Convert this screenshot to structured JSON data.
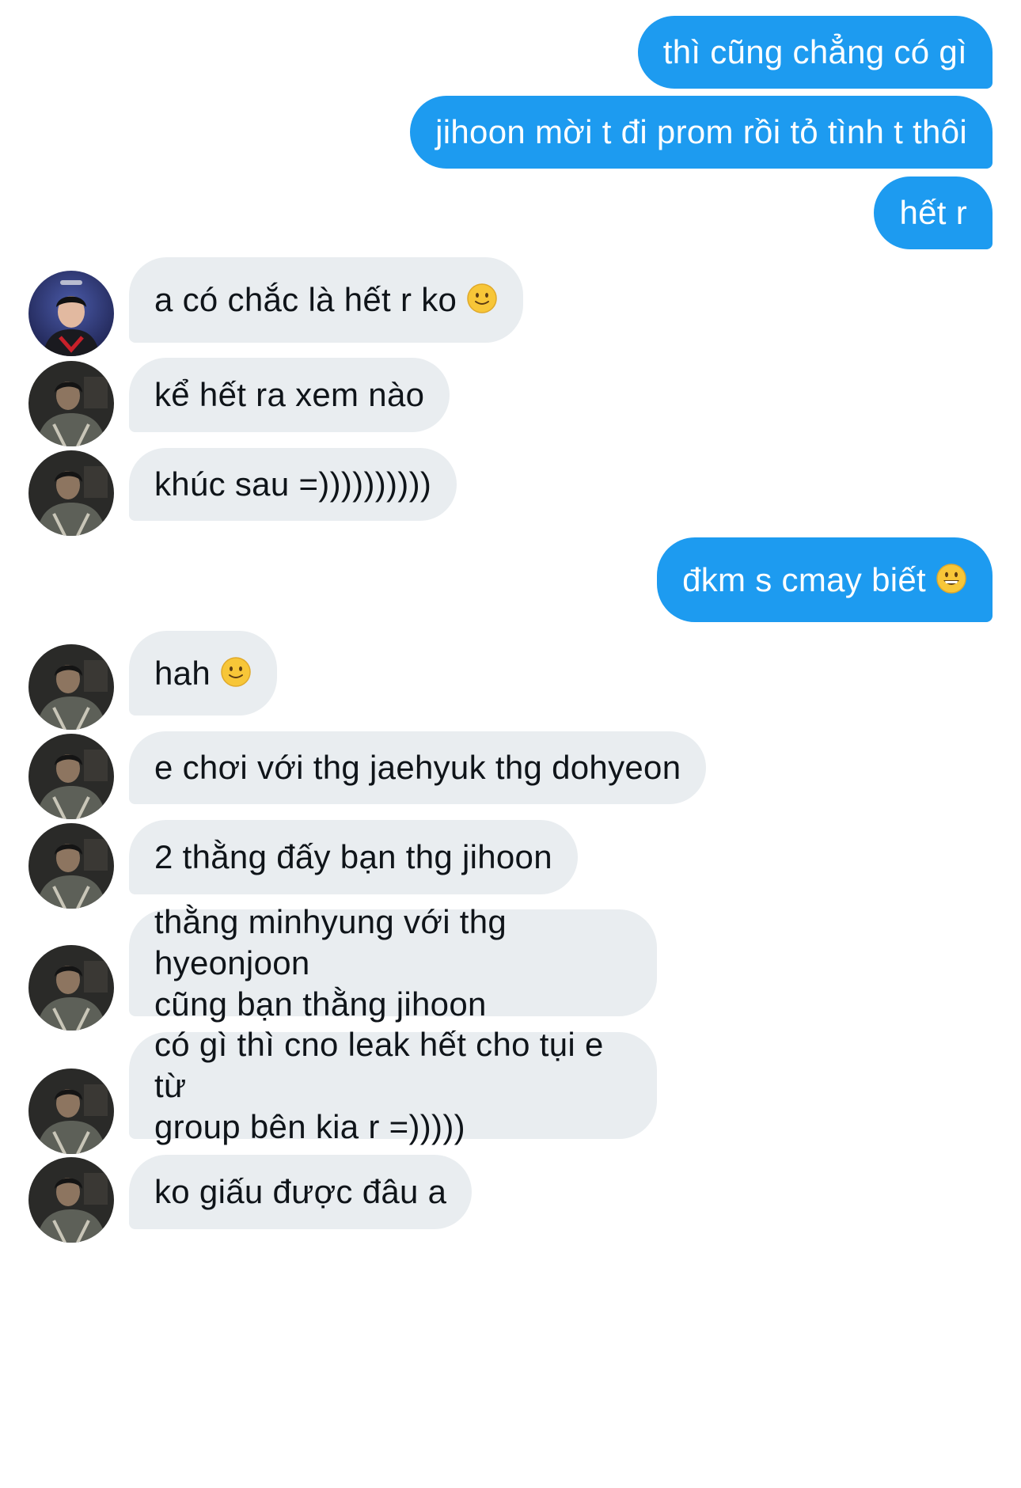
{
  "messages": [
    {
      "side": "sent",
      "text": "thì cũng chẳng có gì"
    },
    {
      "side": "sent",
      "text": "jihoon mời t đi prom rồi tỏ tình t thôi"
    },
    {
      "side": "sent",
      "text": "hết r"
    },
    {
      "side": "received",
      "text": "a có chắc là hết r ko",
      "emoji": "slightly-smiling-face-icon",
      "avatar": "avatar-dark-stage"
    },
    {
      "side": "received",
      "text": "kể hết ra xem nào",
      "avatar": "avatar-dim-jacket"
    },
    {
      "side": "received",
      "text": "khúc sau =))))))))))",
      "avatar": "avatar-dim-jacket"
    },
    {
      "side": "sent",
      "text": "đkm s cmay biết",
      "emoji": "grinning-face-icon"
    },
    {
      "side": "received",
      "text": "hah",
      "emoji": "slightly-smiling-face-icon",
      "avatar": "avatar-dim-jacket"
    },
    {
      "side": "received",
      "text": "e chơi với thg jaehyuk thg dohyeon",
      "avatar": "avatar-dim-jacket"
    },
    {
      "side": "received",
      "text": "2 thằng đấy bạn thg jihoon",
      "avatar": "avatar-dim-jacket"
    },
    {
      "side": "received",
      "text": "thằng minhyung với thg hyeonjoon\ncũng bạn thằng jihoon",
      "avatar": "avatar-dim-jacket"
    },
    {
      "side": "received",
      "text": "có gì thì cno leak hết cho tụi e từ\ngroup bên kia r =)))))",
      "avatar": "avatar-dim-jacket"
    },
    {
      "side": "received",
      "text": "ko giấu được đâu a",
      "avatar": "avatar-dim-jacket"
    }
  ],
  "colors": {
    "sent_bubble": "#1d9bf0",
    "received_bubble": "#e9edf0",
    "sent_text": "#ffffff",
    "received_text": "#0f1419"
  }
}
